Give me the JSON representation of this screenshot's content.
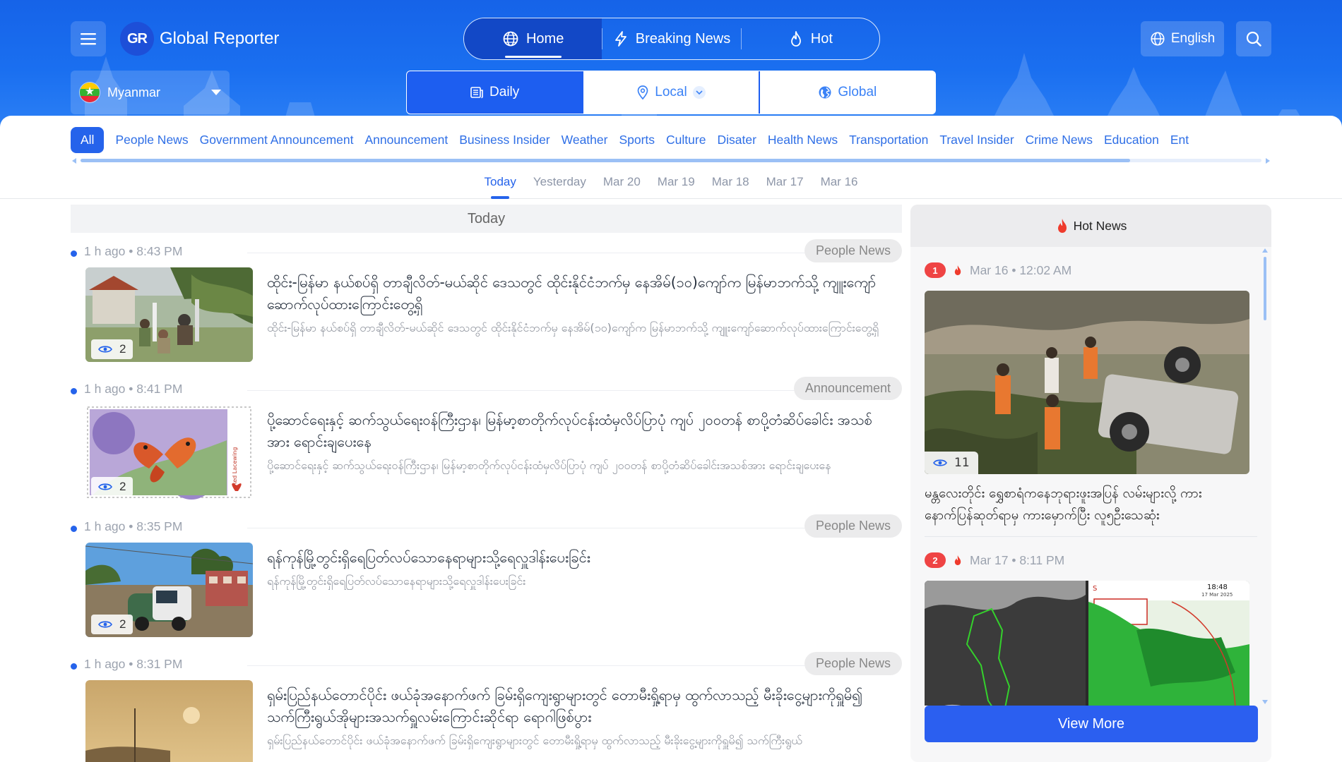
{
  "header": {
    "brand_mark": "GR",
    "brand_name": "Global Reporter",
    "nav": [
      {
        "label": "Home",
        "icon": "globe-icon",
        "active": true
      },
      {
        "label": "Breaking News",
        "icon": "lightning-icon"
      },
      {
        "label": "Hot",
        "icon": "flame-icon"
      }
    ],
    "language": "English",
    "region": "Myanmar",
    "scopes": [
      {
        "label": "Daily",
        "icon": "newspaper-icon",
        "active": true
      },
      {
        "label": "Local",
        "icon": "location-pin-icon"
      },
      {
        "label": "Global",
        "icon": "earth-icon"
      }
    ],
    "colors": {
      "brand_blue": "#1a6ff0",
      "accent": "#2563eb",
      "hot_red": "#ef4444"
    }
  },
  "categories": [
    "All",
    "People News",
    "Government Announcement",
    "Announcement",
    "Business Insider",
    "Weather",
    "Sports",
    "Culture",
    "Disater",
    "Health News",
    "Transportation",
    "Travel Insider",
    "Crime News",
    "Education",
    "Ent"
  ],
  "date_tabs": [
    "Today",
    "Yesterday",
    "Mar 20",
    "Mar 19",
    "Mar 18",
    "Mar 17",
    "Mar 16"
  ],
  "feed": {
    "heading": "Today",
    "items": [
      {
        "time": "1 h ago • 8:43 PM",
        "tag": "People News",
        "views": "2",
        "title": "ထိုင်း-မြန်မာ နယ်စပ်ရှိ တာချီလိတ်-မယ်ဆိုင် ဒေသတွင် ထိုင်းနိုင်ငံဘက်မှ နေအိမ်(၁၀)ကျော်က မြန်မာဘက်သို့ ကျူးကျော်ဆောက်လုပ်ထားကြောင်းတွေ့ရှိ",
        "desc": "ထိုင်း-မြန်မာ နယ်စပ်ရှိ တာချီလိတ်-မယ်ဆိုင် ဒေသတွင် ထိုင်းနိုင်ငံဘက်မှ နေအိမ်(၁၀)ကျော်က မြန်မာဘက်သို့ ကျူးကျော်ဆောက်လုပ်ထားကြောင်းတွေ့ရှိ"
      },
      {
        "time": "1 h ago • 8:41 PM",
        "tag": "Announcement",
        "views": "2",
        "title": "ပို့ဆောင်ရေးနှင့် ဆက်သွယ်ရေးဝန်ကြီးဌာန၊ မြန်မာ့စာတိုက်လုပ်ငန်းထံမှလိပ်ပြာပုံ ကျပ် ၂၀၀တန် စာပို့တံဆိပ်ခေါင်း အသစ်အား ရောင်းချပေးနေ",
        "desc": "ပို့ဆောင်ရေးနှင့် ဆက်သွယ်ရေးဝန်ကြီးဌာန၊ မြန်မာ့စာတိုက်လုပ်ငန်းထံမှလိပ်ပြာပုံ ကျပ် ၂၀၀တန် စာပို့တံဆိပ်ခေါင်းအသစ်အား ရောင်းချပေးနေ",
        "stamp_text": "Red Lacewing"
      },
      {
        "time": "1 h ago • 8:35 PM",
        "tag": "People News",
        "views": "2",
        "title": "ရန်ကုန်မြို့တွင်းရှိရေပြတ်လပ်သောနေရာများသို့ရေလှူဒါန်းပေးခြင်း",
        "desc": "ရန်ကုန်မြို့တွင်းရှိရေပြတ်လပ်သောနေရာများသို့ရေလှူဒါန်းပေးခြင်း"
      },
      {
        "time": "1 h ago • 8:31 PM",
        "tag": "People News",
        "views": "",
        "title": "ရှမ်းပြည်နယ်တောင်ပိုင်း ဖယ်ခုံအနောက်ဖက် ခြမ်းရှိကျေးရွာများတွင် တောမီးရှို့ရာမှ ထွက်လာသည့် မီးခိုးငွေ့များကိုရှူမိ၍ သက်ကြီးရွယ်အိုများအသက်ရှူလမ်းကြောင်းဆိုင်ရာ ရောဂါဖြစ်ပွား",
        "desc": "ရှမ်းပြည်နယ်တောင်ပိုင်း ဖယ်ခုံအနောက်ဖက် ခြမ်းရှိကျေးရွာများတွင် တောမီးရှို့ရာမှ ထွက်လာသည့် မီးခိုးငွေ့များကိုရှူမိ၍ သက်ကြီးရွယ်"
      }
    ]
  },
  "hot": {
    "heading": "Hot News",
    "items": [
      {
        "rank": "1",
        "time": "Mar 16 • 12:02 AM",
        "views": "11",
        "title": "မန္တလေးတိုင်း ရွှေစာရံကနေဘုရားဖူးအပြန် လမ်းများလို့ ကား နောက်ပြန်ဆုတ်ရာမှ ကားမှောက်ပြီး လူ၅ဦးသေဆုံး"
      },
      {
        "rank": "2",
        "time": "Mar 17 • 8:11 PM",
        "views": "",
        "title": "",
        "overlay_time": "18:48",
        "overlay_date": "17 Mar 2025"
      }
    ],
    "view_more": "View More"
  }
}
